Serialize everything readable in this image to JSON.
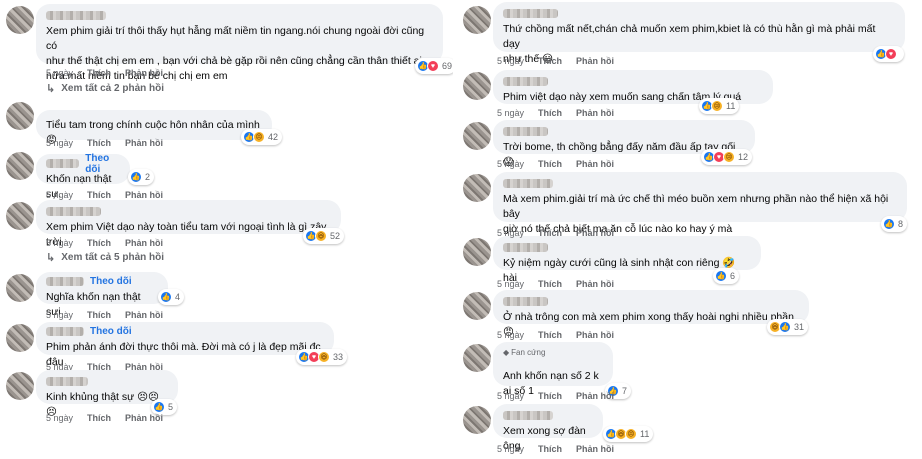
{
  "left": {
    "comments": [
      {
        "text": "Xem phim giải trí thôi thấy hụt hẫng mất niềm tin ngang.nói chung ngoài đời cũng có\nnhư thế thật chị em em , bạn với chả bè gặp rồi nên cũng chẳng cần thân thiết ai\nnữa.mất niềm tin bạn bè chị chị em em",
        "time": "5 ngày",
        "like": "Thích",
        "reply": "Phản hồi",
        "reactions": "69",
        "view_replies": "Xem tất cả 2 phản hồi"
      },
      {
        "text": "Tiểu tam trong chính cuộc hôn nhân của mình 😡",
        "time": "5 ngày",
        "like": "Thích",
        "reply": "Phản hồi",
        "reactions": "42"
      },
      {
        "follow": "Theo dõi",
        "text": "Khốn nạn thật sự.",
        "time": "5 ngày",
        "like": "Thích",
        "reply": "Phản hồi",
        "reactions": "2"
      },
      {
        "text": "Xem phim Việt dạo này toàn tiểu tam với ngoại tình là gì zậy trời",
        "time": "5 ngày",
        "like": "Thích",
        "reply": "Phản hồi",
        "reactions": "52",
        "view_replies": "Xem tất cả 5 phản hồi"
      },
      {
        "follow": "Theo dõi",
        "text": "Nghĩa khốn nạn thật sưi",
        "time": "5 ngày",
        "like": "Thích",
        "reply": "Phản hồi",
        "reactions": "4"
      },
      {
        "follow": "Theo dõi",
        "text": "Phim phản ánh đời thực thôi mà. Đời mà có j là đẹp mãi đc đâu",
        "time": "5 ngày",
        "like": "Thích",
        "reply": "Phản hồi",
        "reactions": "33"
      },
      {
        "text": "Kinh khủng thật sự 😣😣😣",
        "time": "5 ngày",
        "like": "Thích",
        "reply": "Phản hồi",
        "reactions": "5"
      }
    ]
  },
  "right": {
    "comments": [
      {
        "text": "Thứ chồng mất nết,chán chả muốn xem phim,kbiet là có thù hằn gì mà phải mất dạy\nnhư thế 😃",
        "time": "5 ngày",
        "like": "Thích",
        "reply": "Phản hồi",
        "reactions": ""
      },
      {
        "text": "Phim việt dạo này xem muốn sang chấn tâm lý quá",
        "time": "5 ngày",
        "like": "Thích",
        "reply": "Phản hồi",
        "reactions": "11"
      },
      {
        "text": "Trời bome, th chồng bẳng đấy năm đầu ấp tay gối 😱",
        "time": "5 ngày",
        "like": "Thích",
        "reply": "Phản hồi",
        "reactions": "12"
      },
      {
        "text": "Mà xem phim.giải trí mà ức chế thì méo buồn xem nhưng phần nào thể hiện xã hội bây\ngiờ nó thế chả biết ma ăn cỗ lúc nào ko hay ý mà",
        "time": "5 ngày",
        "like": "Thích",
        "reply": "Phản hồi",
        "reactions": "8"
      },
      {
        "text": "Kỷ niệm ngày cưới cũng là sinh nhật con riêng 🤣 hài",
        "time": "5 ngày",
        "like": "Thích",
        "reply": "Phản hồi",
        "reactions": "6"
      },
      {
        "text": "Ở nhà trông con mà xem phim xong thấy hoài nghi nhiều phần 😠",
        "time": "5 ngày",
        "like": "Thích",
        "reply": "Phản hồi",
        "reactions": "31"
      },
      {
        "badge": "Fan cứng",
        "text": "Anh khốn nạn số 2 k ai số 1",
        "time": "5 ngày",
        "like": "Thích",
        "reply": "Phản hồi",
        "reactions": "7"
      },
      {
        "text": "Xem xong sợ đàn ông",
        "time": "5 ngày",
        "like": "Thích",
        "reply": "Phản hồi",
        "reactions": "11"
      }
    ]
  },
  "colors": {
    "bubble": "#f0f2f5",
    "follow": "#2374e1",
    "meta": "#65676b",
    "like": "#1877f2",
    "love": "#f33e58",
    "haha": "#f7b125"
  },
  "icons": {
    "like": "thumbs-up-icon",
    "love": "heart-icon",
    "haha": "laugh-icon",
    "reply": "reply-arrow-icon",
    "fan": "diamond-icon"
  }
}
